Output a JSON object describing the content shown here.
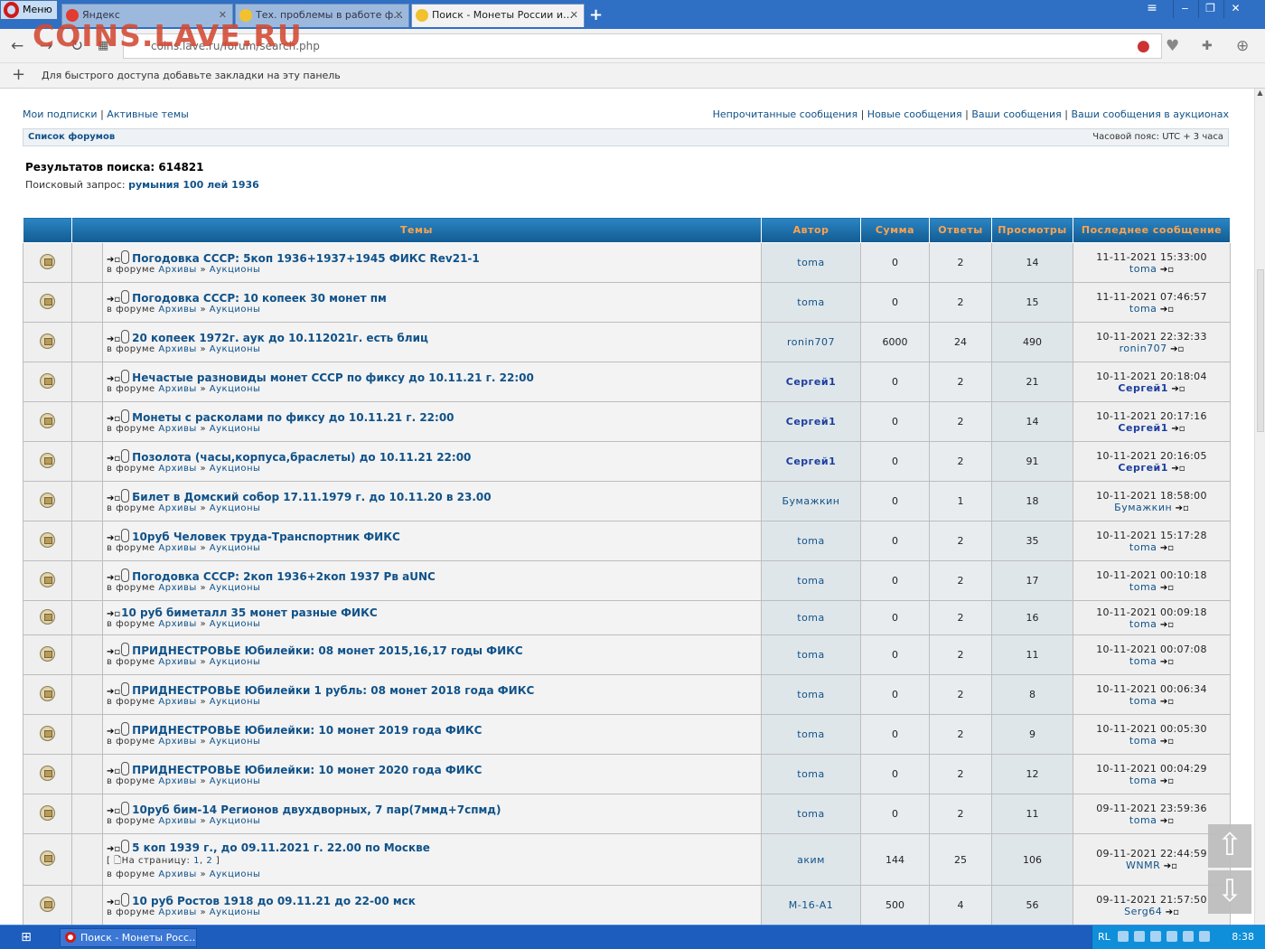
{
  "browser": {
    "menu_label": "Меню",
    "tabs": [
      {
        "label": "Яндекс",
        "icon": "yandex-icon",
        "color": "#e23b2f",
        "active": false
      },
      {
        "label": "Тех. проблемы в работе ф…",
        "icon": "smiley-icon",
        "color": "#f2c12e",
        "active": false
      },
      {
        "label": "Поиск - Монеты России и…",
        "icon": "smiley-icon",
        "color": "#f2c12e",
        "active": true
      }
    ],
    "new_tab": "+",
    "url": "coins.lave.ru/forum/search.php",
    "bookmarks_hint": "Для быстрого доступа добавьте закладки на эту панель",
    "watermark": "COINS.LAVE.RU"
  },
  "nav": {
    "left_links": [
      "Мои подписки",
      "Активные темы"
    ],
    "right_links": [
      "Непрочитанные сообщения",
      "Новые сообщения",
      "Ваши сообщения",
      "Ваши сообщения в аукционах"
    ],
    "forum_list": "Список форумов",
    "timezone": "Часовой пояс: UTC + 3 часа"
  },
  "search": {
    "results_label": "Результатов поиска: 614821",
    "query_label": "Поисковый запрос:",
    "query_value": "румыния 100 лей 1936"
  },
  "table": {
    "headers": [
      "Темы",
      "Автор",
      "Сумма",
      "Ответы",
      "Просмотры",
      "Последнее сообщение"
    ],
    "forum_prefix": "в форуме",
    "forum": "Архивы",
    "subforum": "Аукционы",
    "rows": [
      {
        "title": "Погодовка СССР: 5коп 1936+1937+1945 ФИКС Rev21-1",
        "clip": true,
        "author": "toma",
        "bold": false,
        "sum": "0",
        "replies": "2",
        "views": "14",
        "last_date": "11-11-2021 15:33:00",
        "last_user": "toma"
      },
      {
        "title": "Погодовка СССР: 10 копеек 30 монет пм",
        "clip": true,
        "author": "toma",
        "bold": false,
        "sum": "0",
        "replies": "2",
        "views": "15",
        "last_date": "11-11-2021 07:46:57",
        "last_user": "toma"
      },
      {
        "title": "20 копеек 1972г. аук до 10.112021г. есть блиц",
        "clip": true,
        "author": "ronin707",
        "bold": false,
        "sum": "6000",
        "replies": "24",
        "views": "490",
        "last_date": "10-11-2021 22:32:33",
        "last_user": "ronin707"
      },
      {
        "title": "Нечастые разновиды монет СССР по фиксу до 10.11.21 г. 22:00",
        "clip": true,
        "author": "Сергей1",
        "bold": true,
        "sum": "0",
        "replies": "2",
        "views": "21",
        "last_date": "10-11-2021 20:18:04",
        "last_user": "Сергей1"
      },
      {
        "title": "Монеты с расколами по фиксу до 10.11.21 г. 22:00",
        "clip": true,
        "author": "Сергей1",
        "bold": true,
        "sum": "0",
        "replies": "2",
        "views": "14",
        "last_date": "10-11-2021 20:17:16",
        "last_user": "Сергей1"
      },
      {
        "title": "Позолота (часы,корпуса,браслеты) до 10.11.21 22:00",
        "clip": true,
        "author": "Сергей1",
        "bold": true,
        "sum": "0",
        "replies": "2",
        "views": "91",
        "last_date": "10-11-2021 20:16:05",
        "last_user": "Сергей1"
      },
      {
        "title": "Билет в Домский собор 17.11.1979 г. до 10.11.20 в 23.00",
        "clip": true,
        "author": "Бумажкин",
        "bold": false,
        "sum": "0",
        "replies": "1",
        "views": "18",
        "last_date": "10-11-2021 18:58:00",
        "last_user": "Бумажкин"
      },
      {
        "title": "10руб Человек труда-Транспортник ФИКС",
        "clip": true,
        "author": "toma",
        "bold": false,
        "sum": "0",
        "replies": "2",
        "views": "35",
        "last_date": "10-11-2021 15:17:28",
        "last_user": "toma"
      },
      {
        "title": "Погодовка СССР: 2коп 1936+2коп 1937 Рв aUNC",
        "clip": true,
        "author": "toma",
        "bold": false,
        "sum": "0",
        "replies": "2",
        "views": "17",
        "last_date": "10-11-2021 00:10:18",
        "last_user": "toma"
      },
      {
        "title": "10 руб биметалл 35 монет разные ФИКС",
        "clip": false,
        "author": "toma",
        "bold": false,
        "sum": "0",
        "replies": "2",
        "views": "16",
        "last_date": "10-11-2021 00:09:18",
        "last_user": "toma"
      },
      {
        "title": "ПРИДНЕСТРОВЬЕ Юбилейки: 08 монет 2015,16,17 годы ФИКС",
        "clip": true,
        "author": "toma",
        "bold": false,
        "sum": "0",
        "replies": "2",
        "views": "11",
        "last_date": "10-11-2021 00:07:08",
        "last_user": "toma"
      },
      {
        "title": "ПРИДНЕСТРОВЬЕ Юбилейки 1 рубль: 08 монет 2018 года ФИКС",
        "clip": true,
        "author": "toma",
        "bold": false,
        "sum": "0",
        "replies": "2",
        "views": "8",
        "last_date": "10-11-2021 00:06:34",
        "last_user": "toma"
      },
      {
        "title": "ПРИДНЕСТРОВЬЕ Юбилейки: 10 монет 2019 года ФИКС",
        "clip": true,
        "author": "toma",
        "bold": false,
        "sum": "0",
        "replies": "2",
        "views": "9",
        "last_date": "10-11-2021 00:05:30",
        "last_user": "toma"
      },
      {
        "title": "ПРИДНЕСТРОВЬЕ Юбилейки: 10 монет 2020 года ФИКС",
        "clip": true,
        "author": "toma",
        "bold": false,
        "sum": "0",
        "replies": "2",
        "views": "12",
        "last_date": "10-11-2021 00:04:29",
        "last_user": "toma"
      },
      {
        "title": "10руб бим-14 Регионов двухдворных, 7 пар(7ммд+7спмд)",
        "clip": true,
        "author": "toma",
        "bold": false,
        "sum": "0",
        "replies": "2",
        "views": "11",
        "last_date": "09-11-2021 23:59:36",
        "last_user": "toma"
      },
      {
        "title": "5 коп 1939 г., до 09.11.2021 г. 22.00 по Москве",
        "clip": true,
        "author": "аким",
        "bold": false,
        "sum": "144",
        "replies": "25",
        "views": "106",
        "last_date": "09-11-2021 22:44:59",
        "last_user": "WNMR",
        "pages": {
          "prefix": "[",
          "label": "На страницу:",
          "items": [
            "1",
            "2"
          ],
          "suffix": "]"
        }
      },
      {
        "title": "10 руб Ростов 1918 до 09.11.21 до 22-00 мск",
        "clip": true,
        "author": "М-16-А1",
        "bold": false,
        "sum": "500",
        "replies": "4",
        "views": "56",
        "last_date": "09-11-2021 21:57:50",
        "last_user": "Serg64"
      }
    ]
  },
  "floating": {
    "up": "⇧",
    "down": "⇩"
  },
  "taskbar": {
    "task_label": "Поиск - Монеты Росс…",
    "lang": "RL",
    "clock": "8:38"
  }
}
